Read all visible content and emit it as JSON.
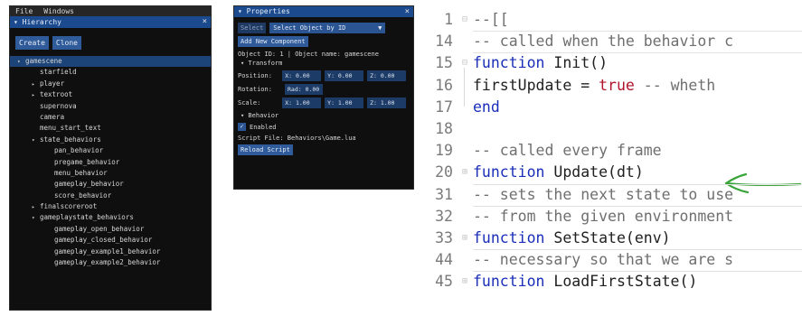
{
  "hierarchy": {
    "menu": [
      "File",
      "Windows"
    ],
    "title": "Hierarchy",
    "close": "×",
    "buttons": {
      "create": "Create",
      "clone": "Clone"
    },
    "items": [
      {
        "label": "gamescene",
        "arrow": "▾"
      },
      {
        "label": "starfield",
        "arrow": ""
      },
      {
        "label": "player",
        "arrow": "▸"
      },
      {
        "label": "textroot",
        "arrow": "▸"
      },
      {
        "label": "supernova",
        "arrow": ""
      },
      {
        "label": "camera",
        "arrow": ""
      },
      {
        "label": "menu_start_text",
        "arrow": ""
      },
      {
        "label": "state_behaviors",
        "arrow": "▾"
      },
      {
        "label": "pan_behavior",
        "arrow": ""
      },
      {
        "label": "pregame_behavior",
        "arrow": ""
      },
      {
        "label": "menu_behavior",
        "arrow": ""
      },
      {
        "label": "gameplay_behavior",
        "arrow": ""
      },
      {
        "label": "score_behavior",
        "arrow": ""
      },
      {
        "label": "finalscoreroot",
        "arrow": "▸"
      },
      {
        "label": "gameplaystate_behaviors",
        "arrow": "▾"
      },
      {
        "label": "gameplay_open_behavior",
        "arrow": ""
      },
      {
        "label": "gameplay_closed_behavior",
        "arrow": ""
      },
      {
        "label": "gameplay_example1_behavior",
        "arrow": ""
      },
      {
        "label": "gameplay_example2_behavior",
        "arrow": ""
      }
    ]
  },
  "properties": {
    "title": "Properties",
    "close": "×",
    "select_button": "Select",
    "select_dropdown": "Select Object by ID",
    "dropdown_arrow": "▼",
    "add_component": "Add New Component",
    "object_info": "Object ID: 1 | Object name: gamescene",
    "transform_header": "▾ Transform",
    "position": {
      "label": "Position:",
      "x": "X: 0.00",
      "y": "Y: 0.00",
      "z": "Z: 0.00"
    },
    "rotation": {
      "label": "Rotation:",
      "rad": "Rad: 0.00"
    },
    "scale": {
      "label": "Scale:",
      "x": "X: 1.00",
      "y": "Y: 1.00",
      "z": "Z: 1.00"
    },
    "behavior_header": "▾ Behavior",
    "check": "✓",
    "enabled_label": "Enabled",
    "script_file": "Script File: Behaviors\\Game.lua",
    "reload_script": "Reload Script"
  },
  "editor": {
    "lines": [
      {
        "num": "1",
        "fold": "⊟",
        "parts": [
          {
            "t": "--[[",
            "c": "cm"
          }
        ]
      },
      {
        "num": "14",
        "fold": "",
        "parts": [
          {
            "t": "-- called when the behavior c",
            "c": "cm"
          }
        ]
      },
      {
        "num": "15",
        "fold": "⊟",
        "parts": [
          {
            "t": "function",
            "c": "kw"
          },
          {
            "t": " Init()",
            "c": "tx"
          }
        ]
      },
      {
        "num": "16",
        "fold": "",
        "parts": [
          {
            "t": "  firstUpdate = ",
            "c": "tx"
          },
          {
            "t": "true",
            "c": "tr"
          },
          {
            "t": " -- wheth",
            "c": "cm"
          }
        ]
      },
      {
        "num": "17",
        "fold": "",
        "parts": [
          {
            "t": "end",
            "c": "kw"
          }
        ]
      },
      {
        "num": "18",
        "fold": "",
        "parts": []
      },
      {
        "num": "19",
        "fold": "",
        "parts": [
          {
            "t": "-- called every frame",
            "c": "cm"
          }
        ]
      },
      {
        "num": "20",
        "fold": "⊞",
        "parts": [
          {
            "t": "function",
            "c": "kw"
          },
          {
            "t": " Update(dt)",
            "c": "tx"
          }
        ]
      },
      {
        "num": "31",
        "fold": "",
        "parts": [
          {
            "t": "-- sets the next state to use",
            "c": "cm"
          }
        ]
      },
      {
        "num": "32",
        "fold": "",
        "parts": [
          {
            "t": "-- from the given environment",
            "c": "cm"
          }
        ]
      },
      {
        "num": "33",
        "fold": "⊞",
        "parts": [
          {
            "t": "function",
            "c": "kw"
          },
          {
            "t": " SetState(env)",
            "c": "tx"
          }
        ]
      },
      {
        "num": "44",
        "fold": "",
        "parts": [
          {
            "t": "-- necessary so that we are s",
            "c": "cm"
          }
        ]
      },
      {
        "num": "45",
        "fold": "⊞",
        "parts": [
          {
            "t": "function",
            "c": "kw"
          },
          {
            "t": " LoadFirstState()",
            "c": "tx"
          }
        ]
      }
    ],
    "annotation_color": "#3aa43a"
  }
}
